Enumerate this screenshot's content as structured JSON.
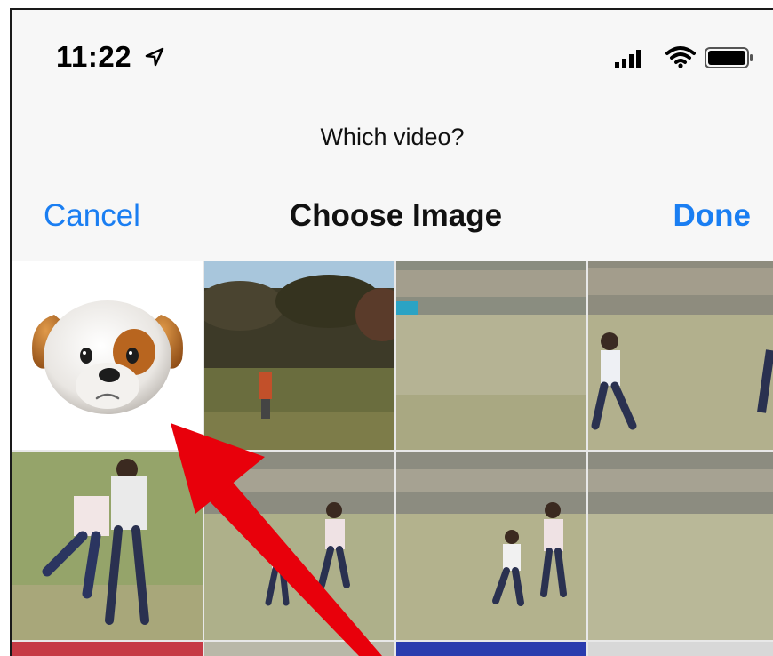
{
  "status_bar": {
    "time": "11:22",
    "location_icon": "location-arrow-icon",
    "signal_icon": "cellular-signal-icon",
    "wifi_icon": "wifi-icon",
    "battery_icon": "battery-icon"
  },
  "prompt": "Which video?",
  "nav": {
    "cancel_label": "Cancel",
    "title": "Choose Image",
    "done_label": "Done"
  },
  "colors": {
    "accent": "#1a7ef2",
    "arrow": "#e8000b"
  },
  "grid": {
    "items": [
      {
        "kind": "animoji",
        "icon": "dog-animoji-icon"
      },
      {
        "kind": "video-thumbnail"
      },
      {
        "kind": "video-thumbnail"
      },
      {
        "kind": "video-thumbnail"
      },
      {
        "kind": "video-thumbnail"
      },
      {
        "kind": "video-thumbnail"
      },
      {
        "kind": "video-thumbnail"
      },
      {
        "kind": "video-thumbnail"
      }
    ]
  },
  "annotation": {
    "icon": "red-arrow-icon"
  }
}
